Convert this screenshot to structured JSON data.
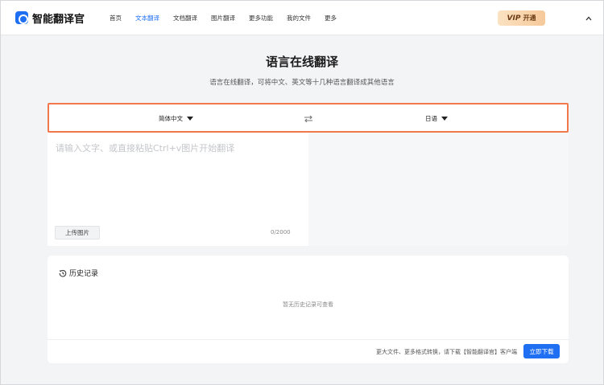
{
  "header": {
    "brand": "智能翻译官",
    "nav": [
      {
        "label": "首页",
        "active": false
      },
      {
        "label": "文本翻译",
        "active": true
      },
      {
        "label": "文档翻译",
        "active": false
      },
      {
        "label": "图片翻译",
        "active": false
      },
      {
        "label": "更多功能",
        "active": false
      },
      {
        "label": "我的文件",
        "active": false
      },
      {
        "label": "更多",
        "active": false
      }
    ],
    "vip_word": "VIP",
    "vip_action": "开通",
    "collapse_icon": "chevron-up-icon"
  },
  "main": {
    "title": "语言在线翻译",
    "subtitle": "语言在线翻译，可将中文、英文等十几种语言翻译成其他语言"
  },
  "translator": {
    "source_lang": "简体中文",
    "target_lang": "日语",
    "swap_icon": "swap-arrows-icon",
    "input_value": "",
    "input_placeholder": "请输入文字、或直接粘贴Ctrl+v图片开始翻译",
    "upload_label": "上传图片",
    "char_count": "0/2000"
  },
  "history": {
    "title": "历史记录",
    "icon": "history-clock-icon",
    "empty_text": "暂无历史记录可查看"
  },
  "footer": {
    "promo_text": "更大文件、更多格式转换，请下载【智能翻译官】客户端",
    "download_label": "立即下载"
  },
  "colors": {
    "accent": "#1f6ff2",
    "highlight_border": "#f2784b",
    "vip_gold": "#f6c99a"
  }
}
